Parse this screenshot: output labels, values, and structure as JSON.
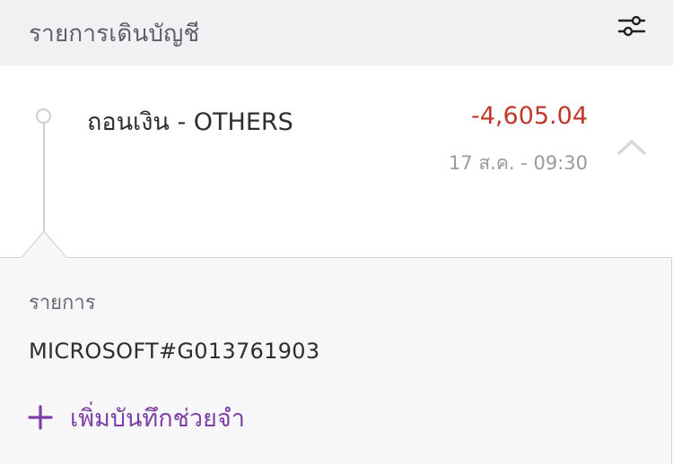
{
  "header": {
    "title": "รายการเดินบัญชี",
    "filter_icon": "sliders-icon"
  },
  "transaction": {
    "title": "ถอนเงิน - OTHERS",
    "amount": "-4,605.04",
    "date_time": "17 ส.ค. - 09:30",
    "amount_color": "#c0392b",
    "expanded": true,
    "collapse_icon": "chevron-up-icon"
  },
  "details": {
    "label": "รายการ",
    "value": "MICROSOFT#G013761903",
    "add_note_label": "เพิ่มบันทึกช่วยจำ",
    "add_note_icon": "plus-icon",
    "accent_color": "#7d3fa6"
  }
}
